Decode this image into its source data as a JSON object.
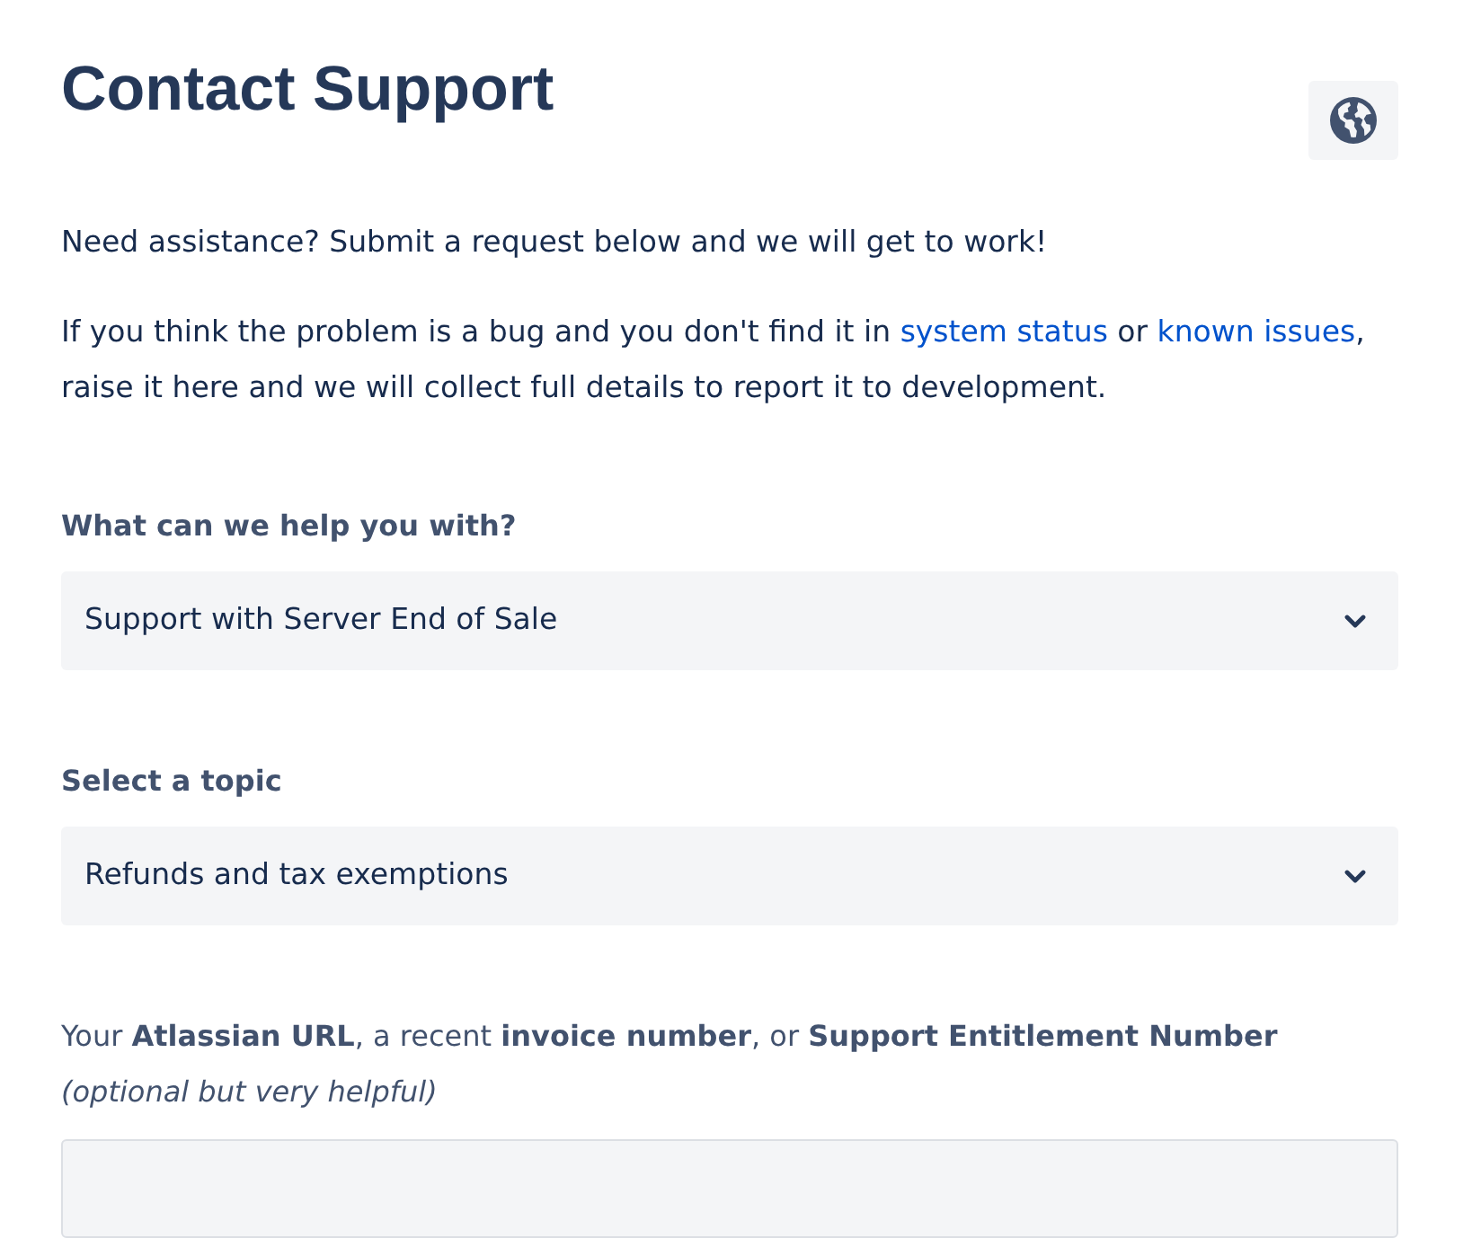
{
  "title": "Contact Support",
  "intro": "Need assistance? Submit a request below and we will get to work!",
  "bug_note": [
    {
      "kind": "text",
      "text": "If you think the problem is a bug and you don't find it in "
    },
    {
      "kind": "link",
      "text": "system status"
    },
    {
      "kind": "text",
      "text": " or "
    },
    {
      "kind": "link",
      "text": "known issues"
    },
    {
      "kind": "text",
      "text": ", raise it here and we will collect full details to report it to development."
    }
  ],
  "fields": [
    {
      "kind": "select",
      "label": "What can we help you with?",
      "value": "Support with Server End of Sale"
    },
    {
      "kind": "select",
      "label": "Select a topic",
      "value": "Refunds and tax exemptions"
    },
    {
      "kind": "text",
      "label": "Your **Atlassian URL**, a recent **invoice number**, or **Support Entitlement Number**",
      "hint": "(optional but very helpful)"
    }
  ]
}
